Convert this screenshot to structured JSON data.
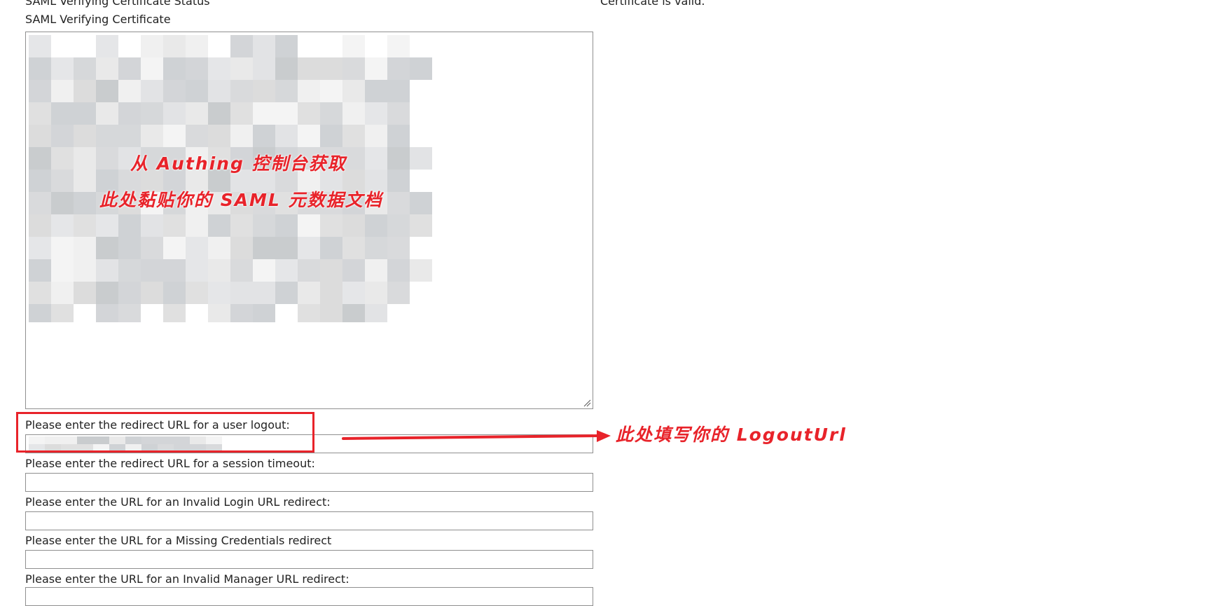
{
  "status": {
    "label": "SAML Verifying Certificate Status",
    "value": "Certificate is valid."
  },
  "certificate": {
    "label": "SAML Verifying Certificate",
    "value": ""
  },
  "annotations": {
    "metadata_line1": "从 Authing 控制台获取",
    "metadata_line2": "此处黏贴你的 SAML 元数据文档",
    "logout_hint": "此处填写你的 LogoutUrl",
    "color": "#e8232a"
  },
  "fields": [
    {
      "label": "Please enter the redirect URL for a user logout:",
      "value": ""
    },
    {
      "label": "Please enter the redirect URL for a session timeout:",
      "value": ""
    },
    {
      "label": "Please enter the URL for an Invalid Login URL redirect:",
      "value": ""
    },
    {
      "label": "Please enter the URL for a Missing Credentials redirect",
      "value": ""
    },
    {
      "label": "Please enter the URL for an Invalid Manager URL redirect:",
      "value": ""
    }
  ]
}
